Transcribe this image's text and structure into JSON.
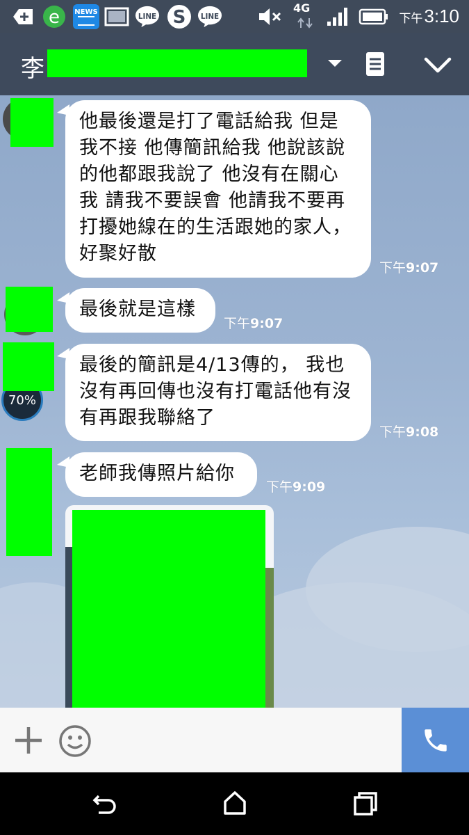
{
  "status_bar": {
    "app_icons": [
      "plus-square-icon",
      "ie-browser-icon",
      "news-app-icon",
      "image-icon",
      "line-icon",
      "skype-icon",
      "line-icon"
    ],
    "news_label": "NEWS",
    "line_label": "LINE",
    "network": "4G",
    "time_prefix": "下午",
    "time": "3:10"
  },
  "header": {
    "title_first_char": "李"
  },
  "messages": [
    {
      "text": "他最後還是打了電話給我 但是我不接 他傳簡訊給我 他說該說的他都跟我說了 他沒有在關心我 請我不要誤會 他請我不要再打擾她線在的生活跟她的家人，好聚好散",
      "time_prefix": "下午",
      "time": "9:07"
    },
    {
      "text": "最後就是這樣",
      "time_prefix": "下午",
      "time": "9:07"
    },
    {
      "text": "最後的簡訊是4/13傳的， 我也沒有再回傳也沒有打電話他有沒有再跟我聯絡了",
      "time_prefix": "下午",
      "time": "9:08"
    },
    {
      "text": "老師我傳照片給你",
      "time_prefix": "下午",
      "time": "9:09"
    }
  ],
  "avatar_badge": "70%",
  "colors": {
    "header_bg": "#3e4a5c",
    "call_button": "#5b8fd6",
    "redaction": "#00ff00"
  }
}
